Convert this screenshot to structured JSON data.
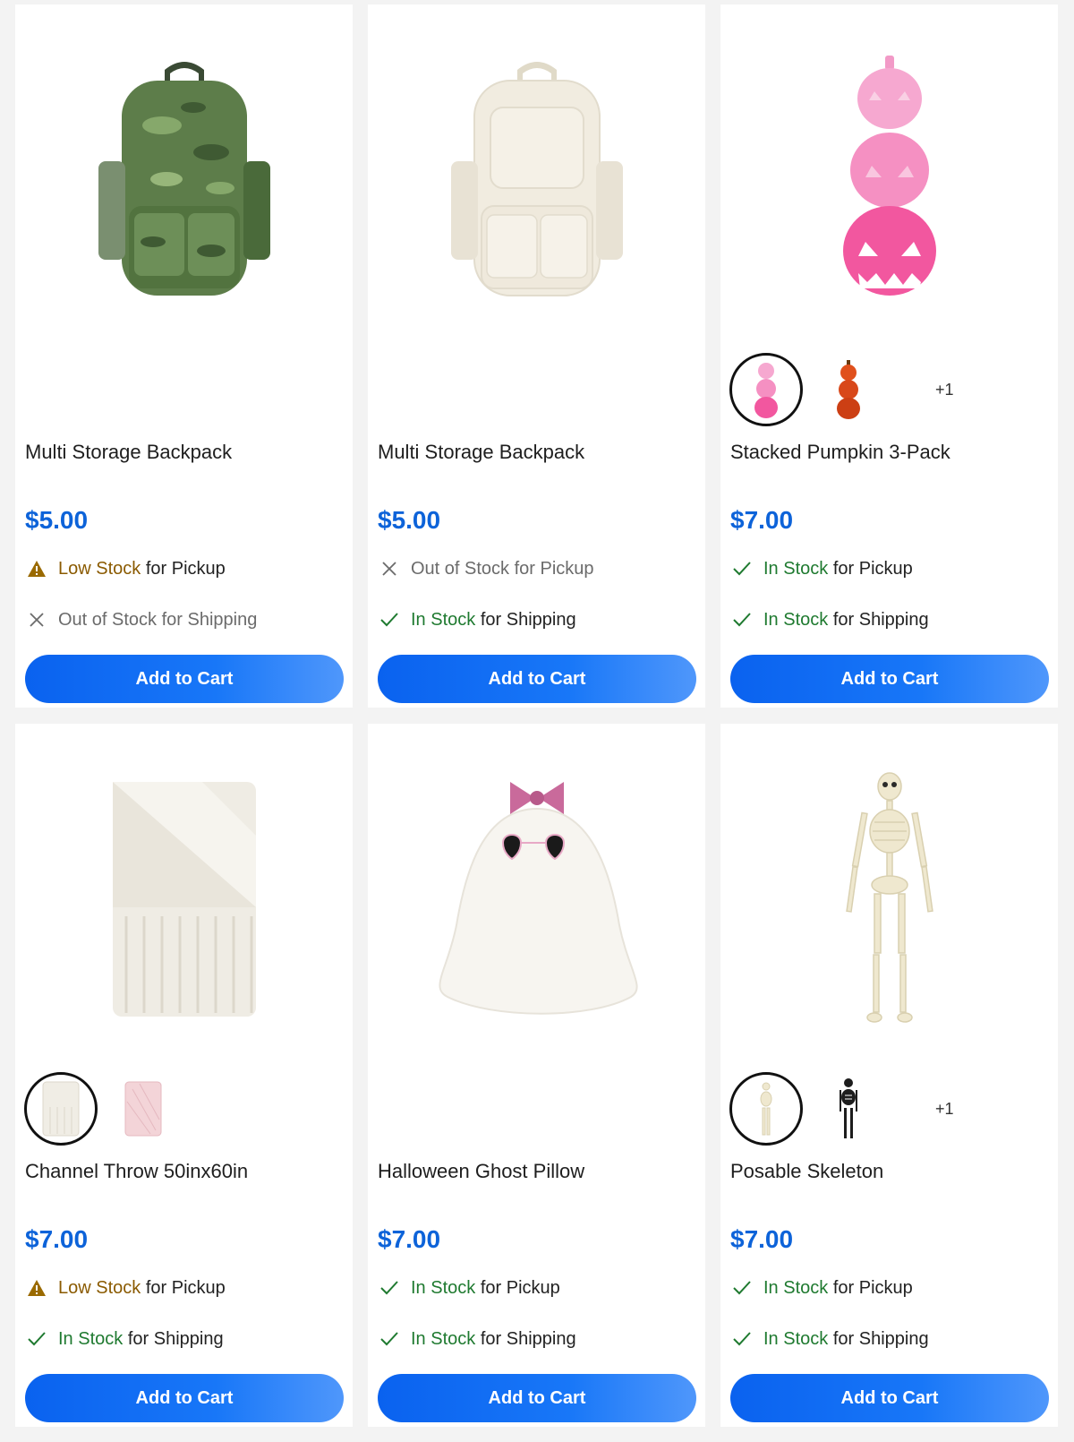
{
  "colors": {
    "price": "#0d63d9",
    "button": "#0a62ef",
    "low_stock": "#8a5a00",
    "in_stock": "#1f7a30",
    "out_of_stock": "#6b6b6b"
  },
  "products": [
    {
      "title": "Multi Storage Backpack",
      "price": "$5.00",
      "image_icon": "green-dinosaur-backpack",
      "pickup": {
        "status": "Low Stock",
        "method": "for Pickup",
        "icon": "warning-icon"
      },
      "shipping": {
        "status": "Out of Stock",
        "method": "for Shipping",
        "icon": "x-icon"
      },
      "button": "Add to Cart"
    },
    {
      "title": "Multi Storage Backpack",
      "price": "$5.00",
      "image_icon": "cream-backpack",
      "pickup": {
        "status": "Out of Stock",
        "method": "for Pickup",
        "icon": "x-icon"
      },
      "shipping": {
        "status": "In Stock",
        "method": "for Shipping",
        "icon": "check-icon"
      },
      "button": "Add to Cart"
    },
    {
      "title": "Stacked Pumpkin 3-Pack",
      "price": "$7.00",
      "image_icon": "pink-stacked-pumpkins",
      "swatch_more": "+1",
      "pickup": {
        "status": "In Stock",
        "method": "for Pickup",
        "icon": "check-icon"
      },
      "shipping": {
        "status": "In Stock",
        "method": "for Shipping",
        "icon": "check-icon"
      },
      "button": "Add to Cart"
    },
    {
      "title": "Channel Throw 50inx60in",
      "price": "$7.00",
      "image_icon": "cream-throw-blanket",
      "pickup": {
        "status": "Low Stock",
        "method": "for Pickup",
        "icon": "warning-icon"
      },
      "shipping": {
        "status": "In Stock",
        "method": "for Shipping",
        "icon": "check-icon"
      },
      "button": "Add to Cart"
    },
    {
      "title": "Halloween Ghost Pillow",
      "price": "$7.00",
      "image_icon": "ghost-pillow",
      "pickup": {
        "status": "In Stock",
        "method": "for Pickup",
        "icon": "check-icon"
      },
      "shipping": {
        "status": "In Stock",
        "method": "for Shipping",
        "icon": "check-icon"
      },
      "button": "Add to Cart"
    },
    {
      "title": "Posable Skeleton",
      "price": "$7.00",
      "image_icon": "skeleton",
      "swatch_more": "+1",
      "pickup": {
        "status": "In Stock",
        "method": "for Pickup",
        "icon": "check-icon"
      },
      "shipping": {
        "status": "In Stock",
        "method": "for Shipping",
        "icon": "check-icon"
      },
      "button": "Add to Cart"
    }
  ]
}
